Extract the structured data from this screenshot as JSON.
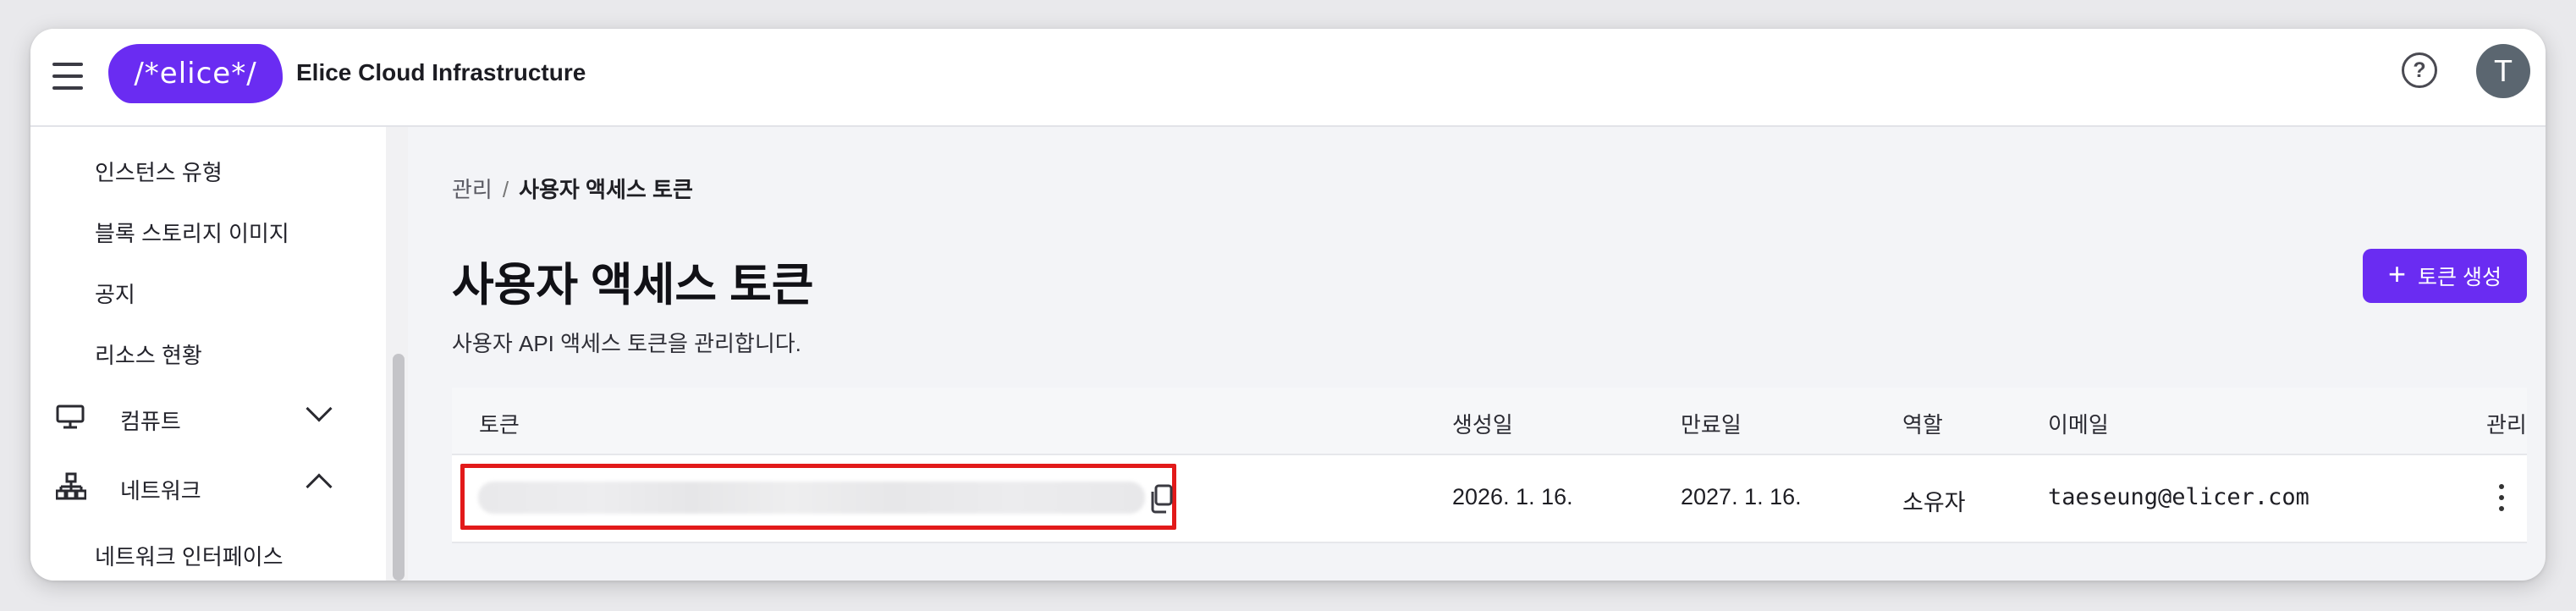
{
  "topbar": {
    "logo_text": "/*elice*/",
    "app_title": "Elice Cloud Infrastructure",
    "help_glyph": "?",
    "avatar_initial": "T",
    "brand_color": "#6a2cf2"
  },
  "sidebar": {
    "items": [
      {
        "label": "인스턴스 유형",
        "type": "subitem"
      },
      {
        "label": "블록 스토리지 이미지",
        "type": "subitem"
      },
      {
        "label": "공지",
        "type": "subitem"
      },
      {
        "label": "리소스 현황",
        "type": "subitem"
      },
      {
        "label": "컴퓨트",
        "type": "group",
        "icon": "monitor-icon",
        "expanded": false
      },
      {
        "label": "네트워크",
        "type": "group",
        "icon": "network-icon",
        "expanded": true
      },
      {
        "label": "네트워크 인터페이스",
        "type": "subitem"
      }
    ]
  },
  "breadcrumb": {
    "parent": "관리",
    "separator": "/",
    "current": "사용자 액세스 토큰"
  },
  "page": {
    "title": "사용자 액세스 토큰",
    "description": "사용자 API 액세스 토큰을 관리합니다.",
    "create_button_label": "토큰 생성",
    "create_button_icon": "plus-icon"
  },
  "table": {
    "headers": {
      "token": "토큰",
      "created": "생성일",
      "expires": "만료일",
      "role": "역할",
      "email": "이메일",
      "manage": "관리"
    },
    "rows": [
      {
        "token_masked": "",
        "created": "2026. 1. 16.",
        "expires": "2027. 1. 16.",
        "role": "소유자",
        "email": "taeseung@elicer.com"
      }
    ]
  },
  "highlight_color": "#e21a1a"
}
